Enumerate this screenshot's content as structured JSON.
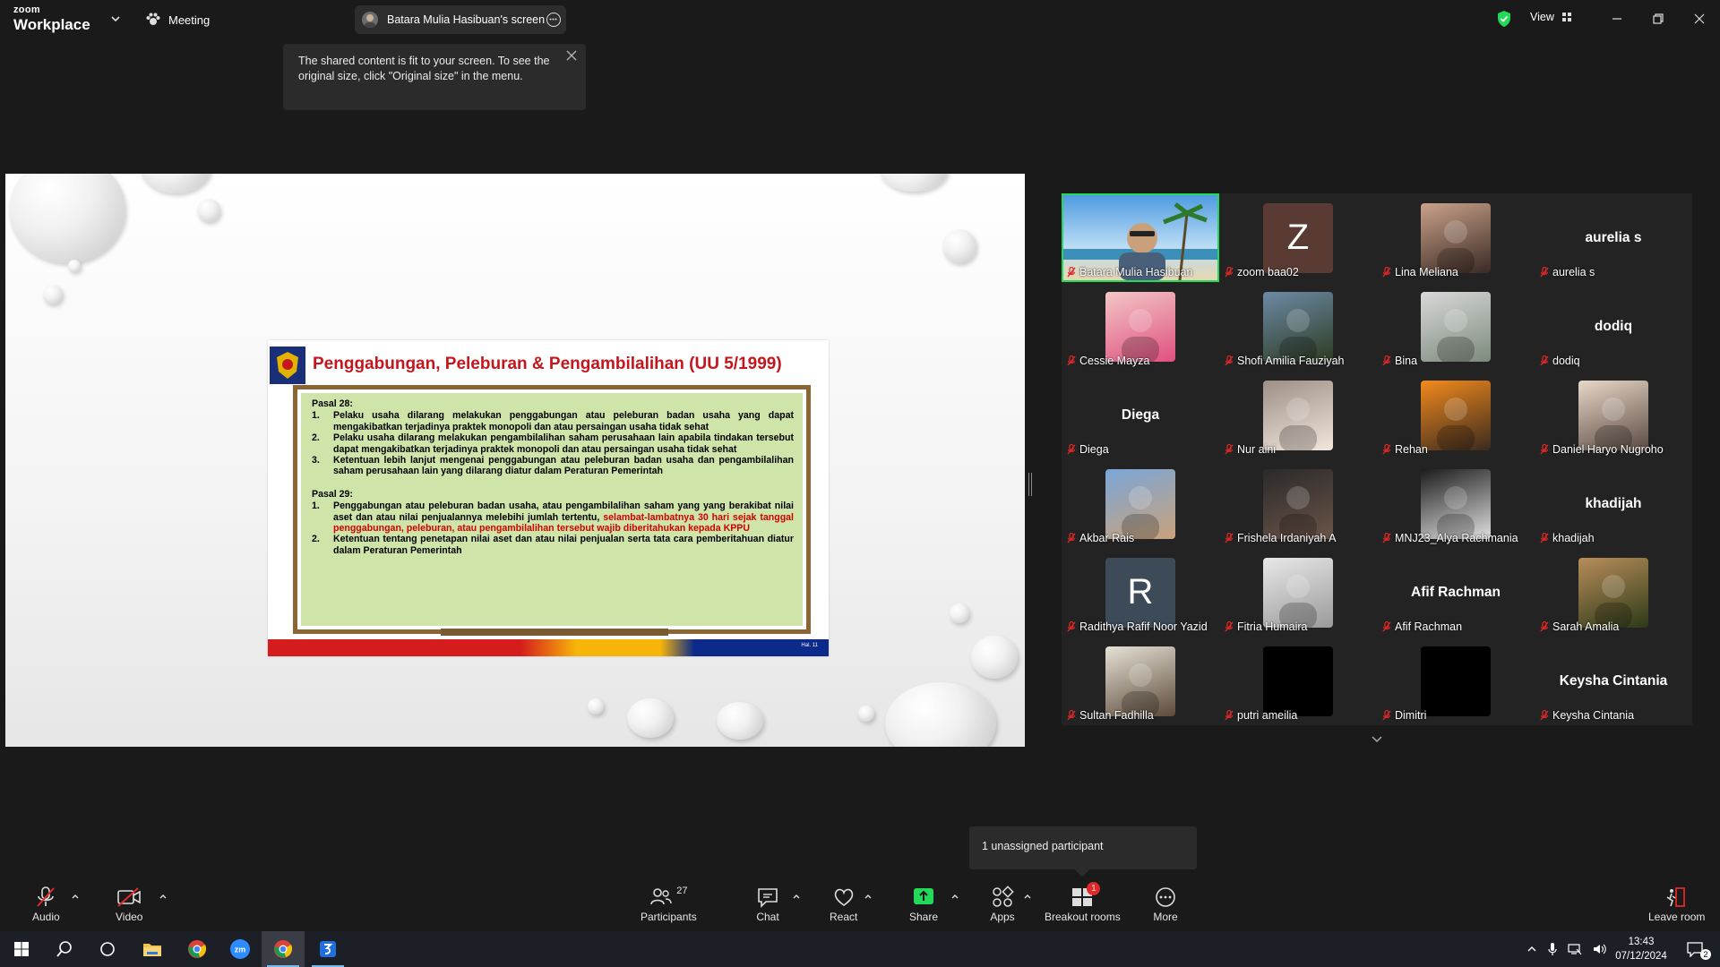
{
  "app": {
    "logo_top": "zoom",
    "logo_bottom": "Workplace",
    "meeting_label": "Meeting",
    "share_pill_label": "Batara Mulia Hasibuan's screen",
    "view_label": "View"
  },
  "tooltip": {
    "text": "The shared content is fit to your screen. To see the original size, click \"Original size\" in the menu."
  },
  "slide": {
    "title": "Penggabungan, Peleburan & Pengambilalihan (UU 5/1999)",
    "pasal28": "Pasal 28:",
    "p28_items": [
      {
        "n": "1.",
        "text": "Pelaku usaha dilarang melakukan penggabungan atau peleburan badan usaha yang dapat mengakibatkan terjadinya praktek monopoli dan atau persaingan usaha tidak sehat"
      },
      {
        "n": "2.",
        "text": "Pelaku usaha dilarang melakukan pengambilalihan saham perusahaan lain apabila tindakan tersebut  dapat mengakibatkan terjadinya praktek monopoli dan atau persaingan usaha tidak sehat"
      },
      {
        "n": "3.",
        "text": "Ketentuan lebih lanjut mengenai penggabungan atau peleburan badan usaha dan pengambilalihan saham perusahaan lain yang dilarang  diatur dalam Peraturan Pemerintah"
      }
    ],
    "pasal29": "Pasal 29:",
    "p29_1_n": "1.",
    "p29_1_black": "Penggabungan atau peleburan badan usaha, atau pengambilalihan saham yang yang berakibat nilai aset dan atau nilai penjualannya melebihi jumlah tertentu, ",
    "p29_1_red": "selambat-lambatnya 30 hari sejak tanggal penggabungan, peleburan, atau pengambilalihan tersebut wajib diberitahukan kepada KPPU",
    "p29_2_n": "2.",
    "p29_2": "Ketentuan tentang penetapan nilai aset dan atau nilai penjualan serta tata cara pemberitahuan diatur dalam Peraturan Pemerintah",
    "page": "Hal. 11"
  },
  "participants": [
    {
      "name": "Batara Mulia Hasibuan",
      "kind": "video",
      "active": true
    },
    {
      "name": "zoom baa02",
      "kind": "letter",
      "letter": "Z",
      "bg": "#5a3b33"
    },
    {
      "name": "Lina Meliana",
      "kind": "photo",
      "c1": "#caa28a",
      "c2": "#3a2a24"
    },
    {
      "name": "aurelia s",
      "kind": "name",
      "big": "aurelia s"
    },
    {
      "name": "Cessie Mayza",
      "kind": "photo",
      "c1": "#f2c7c7",
      "c2": "#e0507e"
    },
    {
      "name": "Shofi Amilia Fauziyah",
      "kind": "photo",
      "c1": "#6d8aa6",
      "c2": "#2d3b22"
    },
    {
      "name": "Bina",
      "kind": "photo",
      "c1": "#d9d9d9",
      "c2": "#7c8a7c"
    },
    {
      "name": "dodiq",
      "kind": "name",
      "big": "dodiq"
    },
    {
      "name": "Diega",
      "kind": "name",
      "big": "Diega"
    },
    {
      "name": "Nur aini",
      "kind": "photo",
      "c1": "#9d8f86",
      "c2": "#f2e6dc"
    },
    {
      "name": "Rehan",
      "kind": "photo",
      "c1": "#f28a1c",
      "c2": "#3a2a1f"
    },
    {
      "name": "Daniel Haryo Nugroho",
      "kind": "photo",
      "c1": "#e8d8c8",
      "c2": "#5a4a42"
    },
    {
      "name": "Akbar Rais",
      "kind": "photo",
      "c1": "#7aa6d8",
      "c2": "#c9a27a"
    },
    {
      "name": "Frishela Irdaniyah A",
      "kind": "photo",
      "c1": "#2a2a2a",
      "c2": "#6b5448"
    },
    {
      "name": "MNJ23_Alya Rachmania",
      "kind": "photo",
      "c1": "#1c1c1c",
      "c2": "#e0e0e0"
    },
    {
      "name": "khadijah",
      "kind": "name",
      "big": "khadijah"
    },
    {
      "name": "Radithya Rafif Noor Yazid",
      "kind": "letter",
      "letter": "R",
      "bg": "#3d4a57"
    },
    {
      "name": "Fitria Humaira",
      "kind": "photo",
      "c1": "#e8e8e8",
      "c2": "#9a9a9a"
    },
    {
      "name": "Afif Rachman",
      "kind": "name",
      "big": "Afif Rachman"
    },
    {
      "name": "Sarah Amalia",
      "kind": "photo",
      "c1": "#b88d5a",
      "c2": "#2d3a18"
    },
    {
      "name": "Sultan Fadhilla",
      "kind": "photo",
      "c1": "#e6e2d6",
      "c2": "#5c4a3a"
    },
    {
      "name": "putri ameilia",
      "kind": "black"
    },
    {
      "name": "Dimitri",
      "kind": "black"
    },
    {
      "name": "Keysha Cintania",
      "kind": "name",
      "big": "Keysha Cintania"
    }
  ],
  "unassigned": "1 unassigned participant",
  "toolbar": {
    "audio": "Audio",
    "video": "Video",
    "participants": "Participants",
    "participants_count": "27",
    "chat": "Chat",
    "react": "React",
    "share": "Share",
    "apps": "Apps",
    "breakout": "Breakout rooms",
    "breakout_badge": "1",
    "more": "More",
    "leave": "Leave room"
  },
  "taskbar": {
    "time": "13:43",
    "date": "07/12/2024",
    "notif_count": "2"
  },
  "colors": {
    "active_border": "#23d959",
    "share_green": "#23d959",
    "mic_off_red": "#e02828",
    "leave_red": "#e02828"
  }
}
